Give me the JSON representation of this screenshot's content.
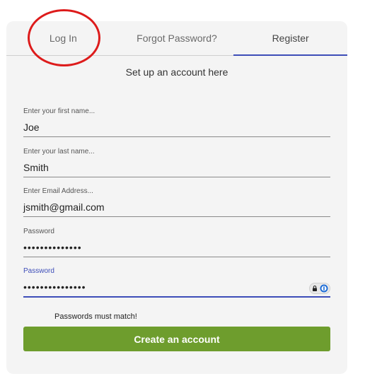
{
  "tabs": [
    {
      "label": "Log In"
    },
    {
      "label": "Forgot Password?"
    },
    {
      "label": "Register"
    }
  ],
  "subtitle": "Set up an account here",
  "fields": {
    "first_name": {
      "label": "Enter your first name...",
      "value": "Joe"
    },
    "last_name": {
      "label": "Enter your last name...",
      "value": "Smith"
    },
    "email": {
      "label": "Enter Email Address...",
      "value": "jsmith@gmail.com"
    },
    "password": {
      "label": "Password",
      "value": "••••••••••••••"
    },
    "confirm_password": {
      "label": "Password",
      "value": "•••••••••••••••"
    }
  },
  "hint": "Passwords must match!",
  "create_button": "Create an account",
  "colors": {
    "accent": "#3d4db8",
    "button": "#6e9d2d",
    "annotation": "#dd1b1b"
  },
  "icons": [
    "lock-icon",
    "password-manager-icon"
  ]
}
